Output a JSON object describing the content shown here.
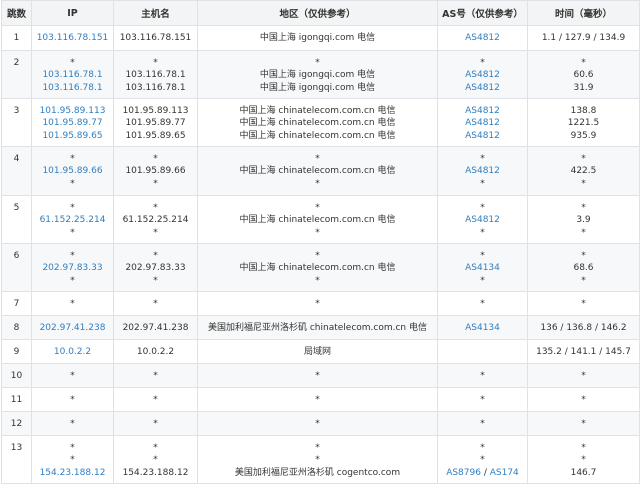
{
  "headers": [
    "跳数",
    "IP",
    "主机名",
    "地区（仅供参考）",
    "AS号（仅供参考）",
    "时间（毫秒）"
  ],
  "rows": [
    {
      "hop": "1",
      "h": 25,
      "lines": [
        {
          "ip": "103.116.78.151",
          "host": "103.116.78.151",
          "region": "中国上海 igongqi.com 电信",
          "as": [
            "AS4812"
          ],
          "time": "1.1 / 127.9 / 134.9"
        }
      ]
    },
    {
      "hop": "2",
      "h": 48,
      "lines": [
        {
          "ip": "*",
          "host": "*",
          "region": "*",
          "as": [
            "*"
          ],
          "time": "*"
        },
        {
          "ip": "103.116.78.1",
          "host": "103.116.78.1",
          "region": "中国上海 igongqi.com 电信",
          "as": [
            "AS4812"
          ],
          "time": "60.6"
        },
        {
          "ip": "103.116.78.1",
          "host": "103.116.78.1",
          "region": "中国上海 igongqi.com 电信",
          "as": [
            "AS4812"
          ],
          "time": "31.9"
        }
      ]
    },
    {
      "hop": "3",
      "h": 48,
      "lines": [
        {
          "ip": "101.95.89.113",
          "host": "101.95.89.113",
          "region": "中国上海 chinatelecom.com.cn 电信",
          "as": [
            "AS4812"
          ],
          "time": "138.8"
        },
        {
          "ip": "101.95.89.77",
          "host": "101.95.89.77",
          "region": "中国上海 chinatelecom.com.cn 电信",
          "as": [
            "AS4812"
          ],
          "time": "1221.5"
        },
        {
          "ip": "101.95.89.65",
          "host": "101.95.89.65",
          "region": "中国上海 chinatelecom.com.cn 电信",
          "as": [
            "AS4812"
          ],
          "time": "935.9"
        }
      ]
    },
    {
      "hop": "4",
      "h": 49,
      "lines": [
        {
          "ip": "*",
          "host": "*",
          "region": "*",
          "as": [
            "*"
          ],
          "time": "*"
        },
        {
          "ip": "101.95.89.66",
          "host": "101.95.89.66",
          "region": "中国上海 chinatelecom.com.cn 电信",
          "as": [
            "AS4812"
          ],
          "time": "422.5"
        },
        {
          "ip": "*",
          "host": "*",
          "region": "*",
          "as": [
            "*"
          ],
          "time": "*"
        }
      ]
    },
    {
      "hop": "5",
      "h": 48,
      "lines": [
        {
          "ip": "*",
          "host": "*",
          "region": "*",
          "as": [
            "*"
          ],
          "time": "*"
        },
        {
          "ip": "61.152.25.214",
          "host": "61.152.25.214",
          "region": "中国上海 chinatelecom.com.cn 电信",
          "as": [
            "AS4812"
          ],
          "time": "3.9"
        },
        {
          "ip": "*",
          "host": "*",
          "region": "*",
          "as": [
            "*"
          ],
          "time": "*"
        }
      ]
    },
    {
      "hop": "6",
      "h": 48,
      "lines": [
        {
          "ip": "*",
          "host": "*",
          "region": "*",
          "as": [
            "*"
          ],
          "time": "*"
        },
        {
          "ip": "202.97.83.33",
          "host": "202.97.83.33",
          "region": "中国上海 chinatelecom.com.cn 电信",
          "as": [
            "AS4134"
          ],
          "time": "68.6"
        },
        {
          "ip": "*",
          "host": "*",
          "region": "*",
          "as": [
            "*"
          ],
          "time": "*"
        }
      ]
    },
    {
      "hop": "7",
      "h": 24,
      "lines": [
        {
          "ip": "*",
          "host": "*",
          "region": "*",
          "as": [
            "*"
          ],
          "time": "*"
        }
      ]
    },
    {
      "hop": "8",
      "h": 24,
      "lines": [
        {
          "ip": "202.97.41.238",
          "host": "202.97.41.238",
          "region": "美国加利福尼亚州洛杉矶 chinatelecom.com.cn 电信",
          "as": [
            "AS4134"
          ],
          "time": "136 / 136.8 / 146.2"
        }
      ]
    },
    {
      "hop": "9",
      "h": 24,
      "lines": [
        {
          "ip": "10.0.2.2",
          "host": "10.0.2.2",
          "region": "局域网",
          "as": [
            ""
          ],
          "time": "135.2 / 141.1 / 145.7"
        }
      ]
    },
    {
      "hop": "10",
      "h": 24,
      "lines": [
        {
          "ip": "*",
          "host": "*",
          "region": "*",
          "as": [
            "*"
          ],
          "time": "*"
        }
      ]
    },
    {
      "hop": "11",
      "h": 24,
      "lines": [
        {
          "ip": "*",
          "host": "*",
          "region": "*",
          "as": [
            "*"
          ],
          "time": "*"
        }
      ]
    },
    {
      "hop": "12",
      "h": 24,
      "lines": [
        {
          "ip": "*",
          "host": "*",
          "region": "*",
          "as": [
            "*"
          ],
          "time": "*"
        }
      ]
    },
    {
      "hop": "13",
      "h": 48,
      "lines": [
        {
          "ip": "*",
          "host": "*",
          "region": "*",
          "as": [
            "*"
          ],
          "time": "*"
        },
        {
          "ip": "*",
          "host": "*",
          "region": "*",
          "as": [
            "*"
          ],
          "time": "*"
        },
        {
          "ip": "154.23.188.12",
          "host": "154.23.188.12",
          "region": "美国加利福尼亚州洛杉矶 cogentco.com",
          "as": [
            "AS8796",
            "AS174"
          ],
          "time": "146.7"
        }
      ]
    }
  ]
}
